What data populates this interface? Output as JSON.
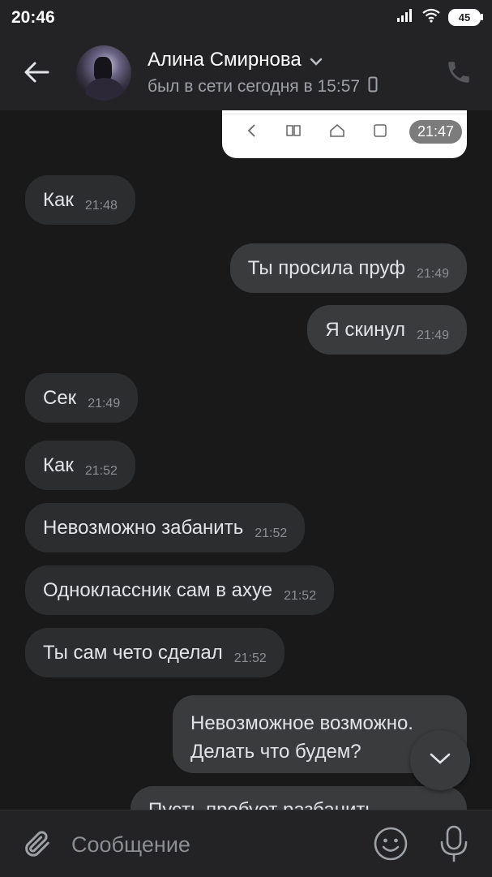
{
  "status_bar": {
    "time": "20:46",
    "battery": "45"
  },
  "header": {
    "contact_name": "Алина Смирнова",
    "last_seen": "был в сети сегодня в 15:57"
  },
  "preview": {
    "time": "21:47"
  },
  "messages": [
    {
      "dir": "in",
      "text": "Как",
      "time": "21:48"
    },
    {
      "dir": "out",
      "text": "Ты просила пруф",
      "time": "21:49"
    },
    {
      "dir": "out",
      "text": "Я скинул",
      "time": "21:49"
    },
    {
      "dir": "in",
      "text": "Сек",
      "time": "21:49"
    },
    {
      "dir": "in",
      "text": "Как",
      "time": "21:52"
    },
    {
      "dir": "in",
      "text": "Невозможно забанить",
      "time": "21:52"
    },
    {
      "dir": "in",
      "text": "Одноклассник сам в ахуе",
      "time": "21:52"
    },
    {
      "dir": "in",
      "text": "Ты сам чето сделал",
      "time": "21:52"
    },
    {
      "dir": "out",
      "lines": [
        "Невозможное возможно.",
        "Делать что будем?"
      ]
    },
    {
      "dir": "out",
      "text": "Пусть пробует разбанить"
    }
  ],
  "composer": {
    "placeholder": "Сообщение"
  },
  "colors": {
    "background": "#19191a",
    "bar": "#232325",
    "bubble_in": "#2c2d2f",
    "bubble_out": "#3a3b3d"
  }
}
